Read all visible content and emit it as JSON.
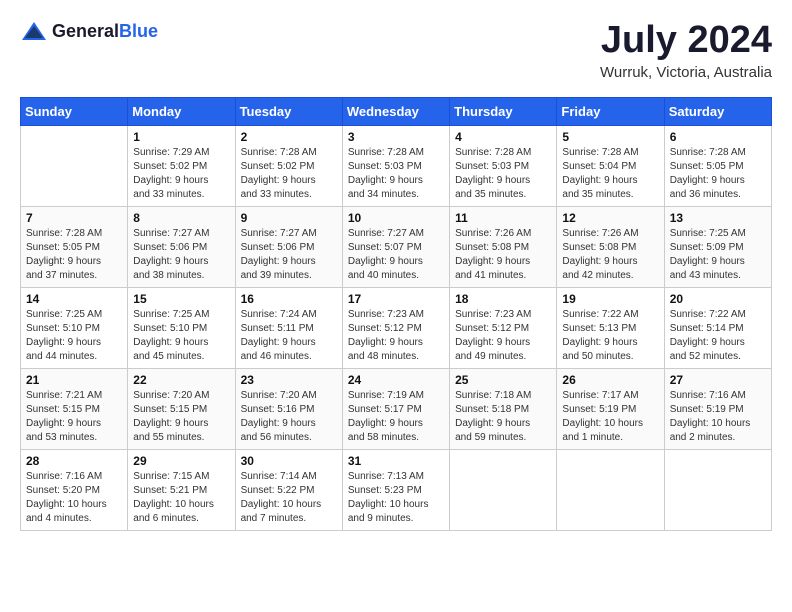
{
  "header": {
    "logo_general": "General",
    "logo_blue": "Blue",
    "title": "July 2024",
    "location": "Wurruk, Victoria, Australia"
  },
  "calendar": {
    "weekdays": [
      "Sunday",
      "Monday",
      "Tuesday",
      "Wednesday",
      "Thursday",
      "Friday",
      "Saturday"
    ],
    "weeks": [
      [
        {
          "day": "",
          "info": ""
        },
        {
          "day": "1",
          "info": "Sunrise: 7:29 AM\nSunset: 5:02 PM\nDaylight: 9 hours\nand 33 minutes."
        },
        {
          "day": "2",
          "info": "Sunrise: 7:28 AM\nSunset: 5:02 PM\nDaylight: 9 hours\nand 33 minutes."
        },
        {
          "day": "3",
          "info": "Sunrise: 7:28 AM\nSunset: 5:03 PM\nDaylight: 9 hours\nand 34 minutes."
        },
        {
          "day": "4",
          "info": "Sunrise: 7:28 AM\nSunset: 5:03 PM\nDaylight: 9 hours\nand 35 minutes."
        },
        {
          "day": "5",
          "info": "Sunrise: 7:28 AM\nSunset: 5:04 PM\nDaylight: 9 hours\nand 35 minutes."
        },
        {
          "day": "6",
          "info": "Sunrise: 7:28 AM\nSunset: 5:05 PM\nDaylight: 9 hours\nand 36 minutes."
        }
      ],
      [
        {
          "day": "7",
          "info": "Sunrise: 7:28 AM\nSunset: 5:05 PM\nDaylight: 9 hours\nand 37 minutes."
        },
        {
          "day": "8",
          "info": "Sunrise: 7:27 AM\nSunset: 5:06 PM\nDaylight: 9 hours\nand 38 minutes."
        },
        {
          "day": "9",
          "info": "Sunrise: 7:27 AM\nSunset: 5:06 PM\nDaylight: 9 hours\nand 39 minutes."
        },
        {
          "day": "10",
          "info": "Sunrise: 7:27 AM\nSunset: 5:07 PM\nDaylight: 9 hours\nand 40 minutes."
        },
        {
          "day": "11",
          "info": "Sunrise: 7:26 AM\nSunset: 5:08 PM\nDaylight: 9 hours\nand 41 minutes."
        },
        {
          "day": "12",
          "info": "Sunrise: 7:26 AM\nSunset: 5:08 PM\nDaylight: 9 hours\nand 42 minutes."
        },
        {
          "day": "13",
          "info": "Sunrise: 7:25 AM\nSunset: 5:09 PM\nDaylight: 9 hours\nand 43 minutes."
        }
      ],
      [
        {
          "day": "14",
          "info": "Sunrise: 7:25 AM\nSunset: 5:10 PM\nDaylight: 9 hours\nand 44 minutes."
        },
        {
          "day": "15",
          "info": "Sunrise: 7:25 AM\nSunset: 5:10 PM\nDaylight: 9 hours\nand 45 minutes."
        },
        {
          "day": "16",
          "info": "Sunrise: 7:24 AM\nSunset: 5:11 PM\nDaylight: 9 hours\nand 46 minutes."
        },
        {
          "day": "17",
          "info": "Sunrise: 7:23 AM\nSunset: 5:12 PM\nDaylight: 9 hours\nand 48 minutes."
        },
        {
          "day": "18",
          "info": "Sunrise: 7:23 AM\nSunset: 5:12 PM\nDaylight: 9 hours\nand 49 minutes."
        },
        {
          "day": "19",
          "info": "Sunrise: 7:22 AM\nSunset: 5:13 PM\nDaylight: 9 hours\nand 50 minutes."
        },
        {
          "day": "20",
          "info": "Sunrise: 7:22 AM\nSunset: 5:14 PM\nDaylight: 9 hours\nand 52 minutes."
        }
      ],
      [
        {
          "day": "21",
          "info": "Sunrise: 7:21 AM\nSunset: 5:15 PM\nDaylight: 9 hours\nand 53 minutes."
        },
        {
          "day": "22",
          "info": "Sunrise: 7:20 AM\nSunset: 5:15 PM\nDaylight: 9 hours\nand 55 minutes."
        },
        {
          "day": "23",
          "info": "Sunrise: 7:20 AM\nSunset: 5:16 PM\nDaylight: 9 hours\nand 56 minutes."
        },
        {
          "day": "24",
          "info": "Sunrise: 7:19 AM\nSunset: 5:17 PM\nDaylight: 9 hours\nand 58 minutes."
        },
        {
          "day": "25",
          "info": "Sunrise: 7:18 AM\nSunset: 5:18 PM\nDaylight: 9 hours\nand 59 minutes."
        },
        {
          "day": "26",
          "info": "Sunrise: 7:17 AM\nSunset: 5:19 PM\nDaylight: 10 hours\nand 1 minute."
        },
        {
          "day": "27",
          "info": "Sunrise: 7:16 AM\nSunset: 5:19 PM\nDaylight: 10 hours\nand 2 minutes."
        }
      ],
      [
        {
          "day": "28",
          "info": "Sunrise: 7:16 AM\nSunset: 5:20 PM\nDaylight: 10 hours\nand 4 minutes."
        },
        {
          "day": "29",
          "info": "Sunrise: 7:15 AM\nSunset: 5:21 PM\nDaylight: 10 hours\nand 6 minutes."
        },
        {
          "day": "30",
          "info": "Sunrise: 7:14 AM\nSunset: 5:22 PM\nDaylight: 10 hours\nand 7 minutes."
        },
        {
          "day": "31",
          "info": "Sunrise: 7:13 AM\nSunset: 5:23 PM\nDaylight: 10 hours\nand 9 minutes."
        },
        {
          "day": "",
          "info": ""
        },
        {
          "day": "",
          "info": ""
        },
        {
          "day": "",
          "info": ""
        }
      ]
    ]
  }
}
